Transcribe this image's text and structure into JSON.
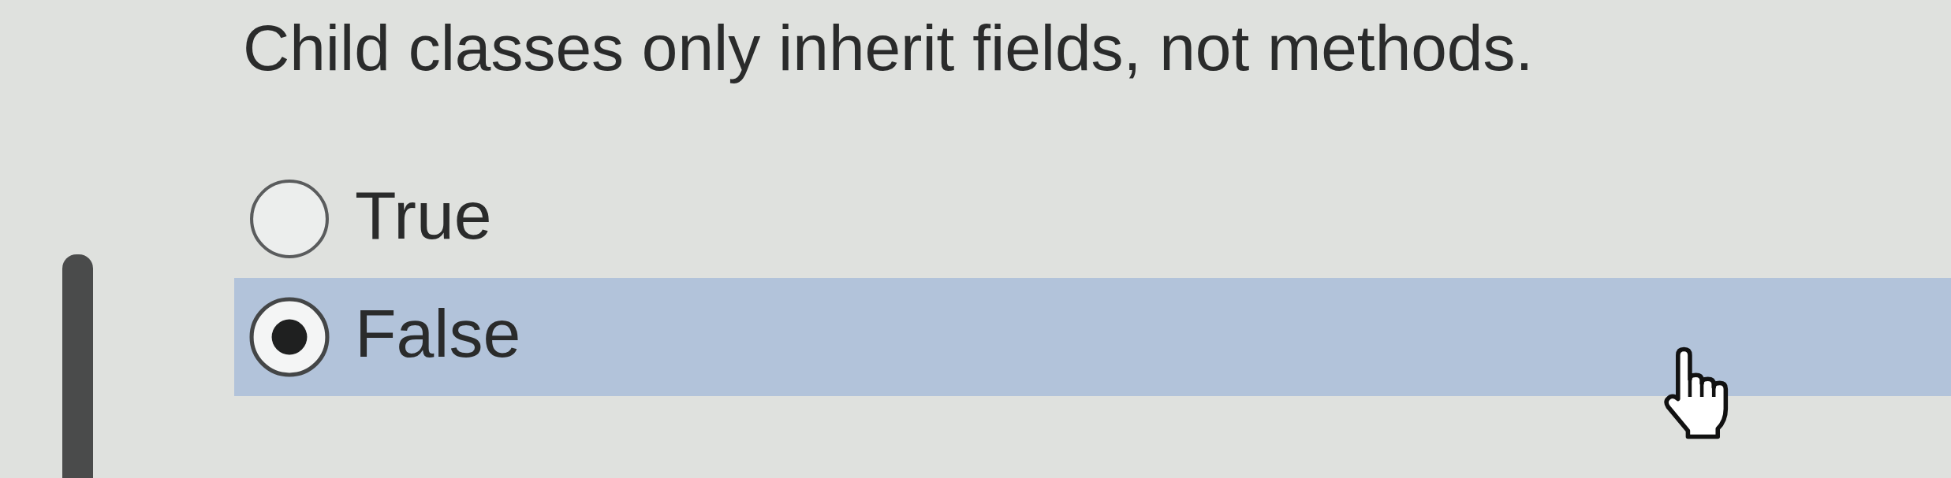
{
  "question": {
    "text": "Child classes only inherit fields, not methods."
  },
  "options": [
    {
      "label": "True",
      "selected": false
    },
    {
      "label": "False",
      "selected": true
    }
  ]
}
